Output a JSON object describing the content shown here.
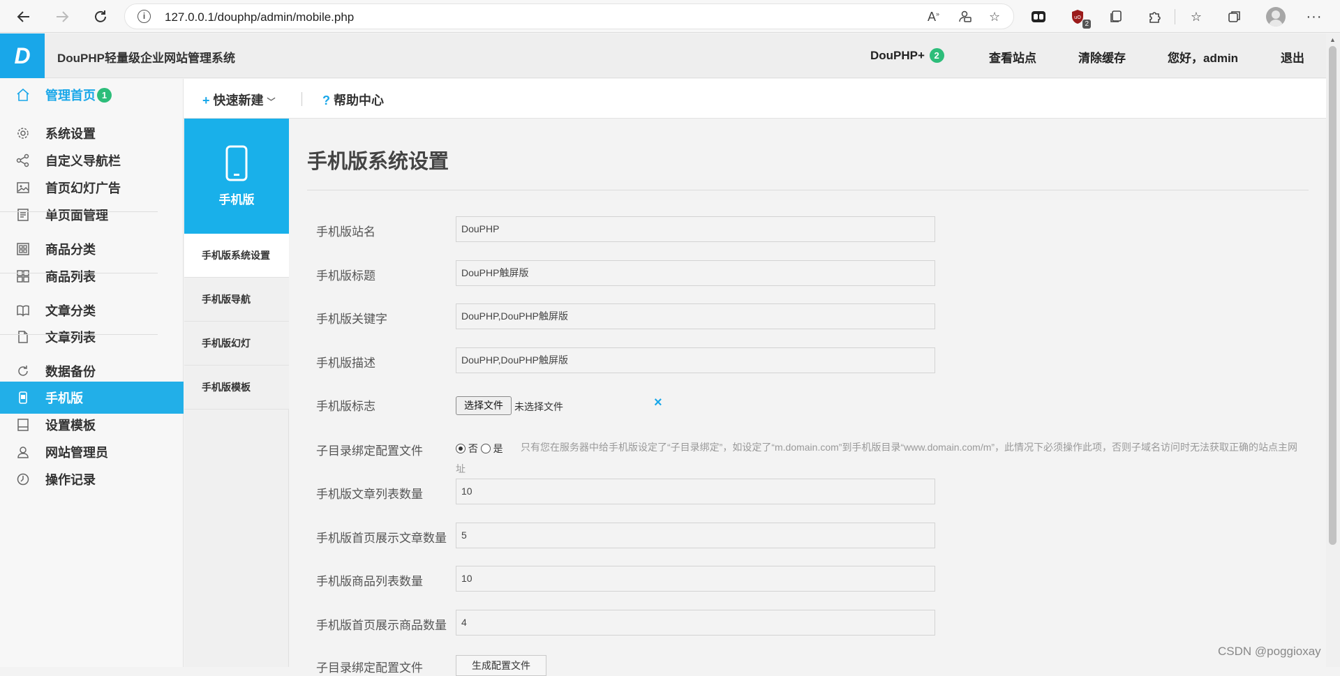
{
  "browser": {
    "url": "127.0.0.1/douphp/admin/mobile.php",
    "ext_badge": "2"
  },
  "header": {
    "logo_text": "D",
    "app_title": "DouPHP轻量级企业网站管理系统",
    "douphp_plus": "DouPHP+",
    "douphp_plus_count": "2",
    "view_site": "查看站点",
    "clear_cache": "清除缓存",
    "greeting": "您好，admin",
    "logout": "退出"
  },
  "toolbar": {
    "quick_new": "快速新建",
    "help_center": "帮助中心"
  },
  "sidebar": {
    "home": "管理首页",
    "home_count": "1",
    "items": [
      {
        "label": "系统设置",
        "icon": "gear-icon"
      },
      {
        "label": "自定义导航栏",
        "icon": "share-icon"
      },
      {
        "label": "首页幻灯广告",
        "icon": "image-icon"
      },
      {
        "label": "单页面管理",
        "icon": "page-icon"
      },
      {
        "label": "商品分类",
        "icon": "category-icon"
      },
      {
        "label": "商品列表",
        "icon": "grid-icon"
      },
      {
        "label": "文章分类",
        "icon": "book-icon"
      },
      {
        "label": "文章列表",
        "icon": "file-icon"
      },
      {
        "label": "数据备份",
        "icon": "refresh-icon"
      },
      {
        "label": "手机版",
        "icon": "mobile-icon"
      },
      {
        "label": "设置模板",
        "icon": "template-icon"
      },
      {
        "label": "网站管理员",
        "icon": "user-icon"
      },
      {
        "label": "操作记录",
        "icon": "clock-icon"
      }
    ]
  },
  "subnav": {
    "header": "手机版",
    "items": [
      "手机版系统设置",
      "手机版导航",
      "手机版幻灯",
      "手机版模板"
    ]
  },
  "main": {
    "title": "手机版系统设置",
    "fields": {
      "site_name": {
        "label": "手机版站名",
        "value": "DouPHP"
      },
      "title": {
        "label": "手机版标题",
        "value": "DouPHP触屏版"
      },
      "keywords": {
        "label": "手机版关键字",
        "value": "DouPHP,DouPHP触屏版"
      },
      "description": {
        "label": "手机版描述",
        "value": "DouPHP,DouPHP触屏版"
      },
      "logo": {
        "label": "手机版标志",
        "button": "选择文件",
        "status": "未选择文件",
        "clear": "×"
      },
      "subdir": {
        "label": "子目录绑定配置文件",
        "opt_no": "否",
        "opt_yes": "是",
        "selected": "否",
        "hint": "只有您在服务器中给手机版设定了“子目录绑定”，如设定了“m.domain.com”到手机版目录“www.domain.com/m”，此情况下必须操作此项，否则子域名访问时无法获取正确的站点主网址"
      },
      "article_list_num": {
        "label": "手机版文章列表数量",
        "value": "10"
      },
      "home_article_num": {
        "label": "手机版首页展示文章数量",
        "value": "5"
      },
      "product_list_num": {
        "label": "手机版商品列表数量",
        "value": "10"
      },
      "home_product_num": {
        "label": "手机版首页展示商品数量",
        "value": "4"
      },
      "subdir_gen": {
        "label": "子目录绑定配置文件",
        "button": "生成配置文件"
      }
    }
  },
  "watermark": "CSDN @poggioxay",
  "colors": {
    "accent": "#19a7e9",
    "badge": "#2dbd7a"
  }
}
